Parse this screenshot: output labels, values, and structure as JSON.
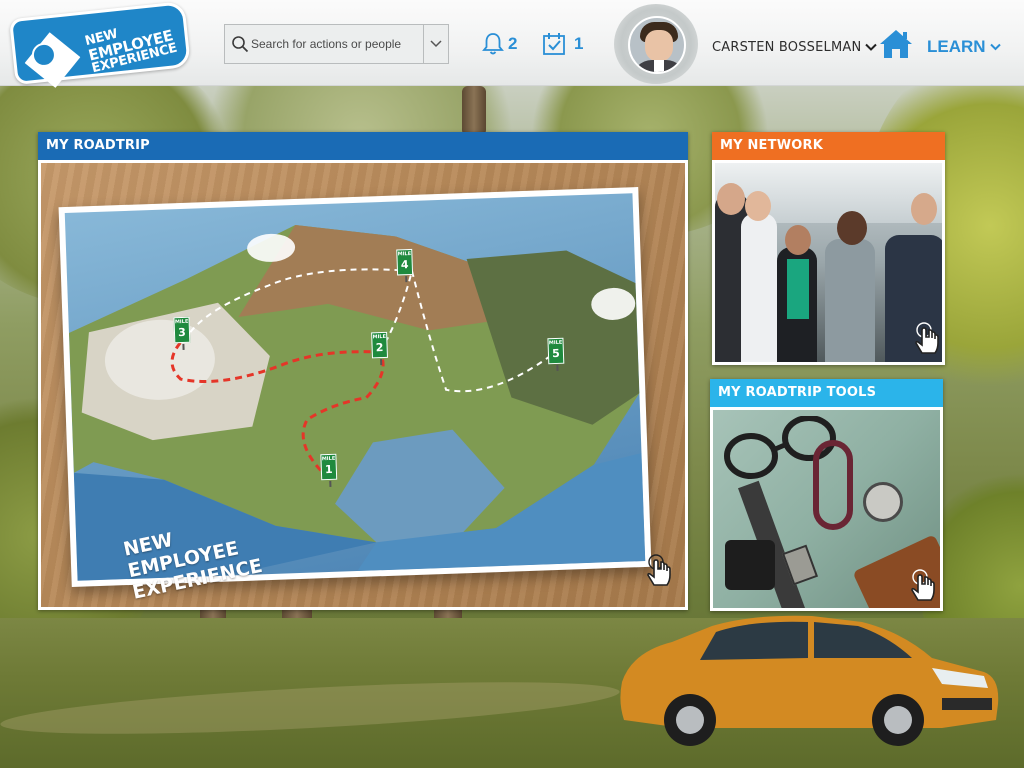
{
  "header": {
    "logo_lines": [
      "NEW",
      "EMPLOYEE",
      "EXPERIENCE"
    ],
    "search_placeholder": "Search for actions or people",
    "notifications_count": "2",
    "tasks_count": "1",
    "user_name": "CARSTEN BOSSELMAN",
    "learn_label": "LEARN"
  },
  "cards": {
    "roadtrip": {
      "title": "MY ROADTRIP",
      "map_title_lines": [
        "NEW",
        "EMPLOYEE",
        "EXPERIENCE"
      ],
      "mile_markers": [
        "1",
        "2",
        "3",
        "4",
        "5"
      ]
    },
    "network": {
      "title": "MY NETWORK"
    },
    "tools": {
      "title": "MY ROADTRIP TOOLS"
    }
  },
  "colors": {
    "brand_blue": "#1a6bb5",
    "accent_blue": "#2a8fd6",
    "network_orange": "#ef6f22",
    "tools_cyan": "#2bb4ea",
    "mile_green": "#1f8a3e"
  },
  "icons": [
    "search-icon",
    "chevron-down-icon",
    "bell-icon",
    "calendar-check-icon",
    "home-icon",
    "tap-hand-icon",
    "compass-icon"
  ]
}
